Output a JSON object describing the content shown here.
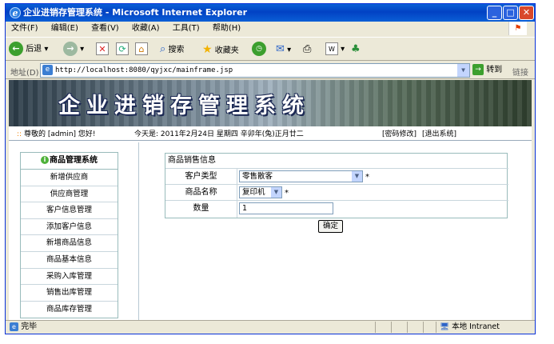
{
  "window": {
    "title": "企业进销存管理系统 - Microsoft Internet Explorer"
  },
  "menu": [
    "文件(F)",
    "编辑(E)",
    "查看(V)",
    "收藏(A)",
    "工具(T)",
    "帮助(H)"
  ],
  "toolbar": {
    "back": "后退",
    "search": "搜索",
    "favorites": "收藏夹"
  },
  "address": {
    "label": "地址(D)",
    "url": "http://localhost:8080/qyjxc/mainframe.jsp",
    "go": "转到",
    "links": "链接"
  },
  "banner": {
    "title": "企业进销存管理系统"
  },
  "infobar": {
    "greeting": "尊敬的 [admin] 您好!",
    "today": "今天是: 2011年2月24日 星期四 辛卯年(兔)正月廿二",
    "change_pwd": "[密码修改]",
    "logout": "[退出系统]"
  },
  "sidebar": {
    "header": "商品管理系统",
    "items": [
      "新增供应商",
      "供应商管理",
      "客户信息管理",
      "添加客户信息",
      "新增商品信息",
      "商品基本信息",
      "采购入库管理",
      "销售出库管理",
      "商品库存管理"
    ]
  },
  "form": {
    "title": "商品销售信息",
    "customer_type_label": "客户类型",
    "customer_type_value": "零售散客",
    "product_label": "商品名称",
    "product_value": "复印机",
    "qty_label": "数量",
    "qty_value": "1",
    "required": "*",
    "submit": "确定"
  },
  "status": {
    "left": "完毕",
    "zone": "本地 Intranet"
  }
}
